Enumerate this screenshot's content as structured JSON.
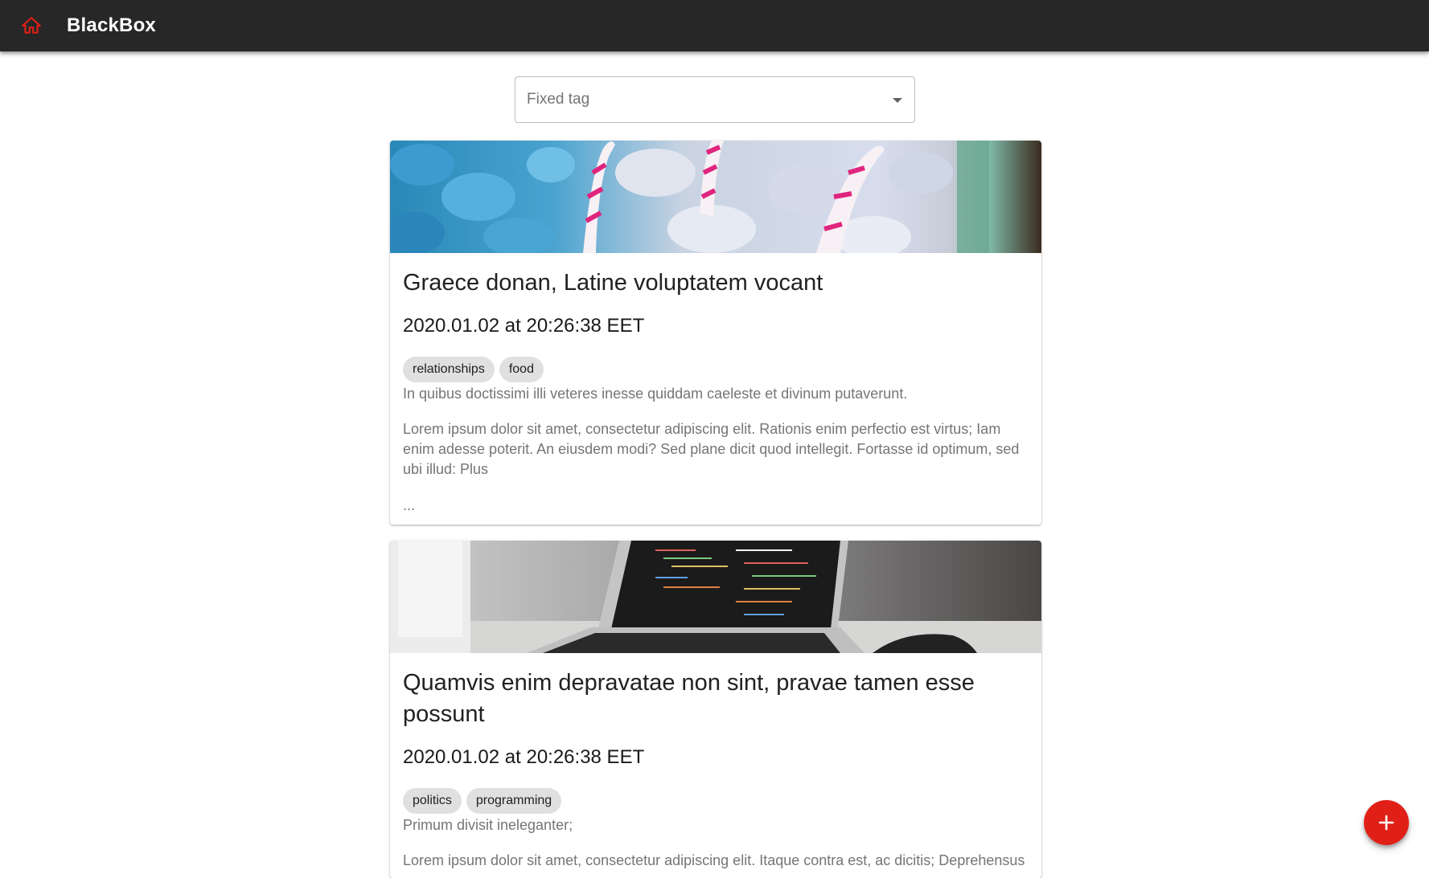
{
  "appbar": {
    "title": "BlackBox",
    "home_icon": "home-icon",
    "accent_color": "#e02017",
    "background": "#272727"
  },
  "filter": {
    "label": "Fixed tag",
    "icon": "arrow-drop-down-icon"
  },
  "posts": [
    {
      "title": "Graece donan, Latine voluptatem vocant",
      "date": "2020.01.02 at 20:26:38 EET",
      "tags": [
        "relationships",
        "food"
      ],
      "subtitle": "In quibus doctissimi illi veteres inesse quiddam caeleste et divinum putaverunt.",
      "excerpt": "Lorem ipsum dolor sit amet, consectetur adipiscing elit. Rationis enim perfectio est virtus; Iam enim adesse poterit. An eiusdem modi? Sed plane dicit quod intellegit. Fortasse id optimum, sed ubi illud: Plus",
      "ellipsis": "...",
      "image": "candy-canes-photo"
    },
    {
      "title": "Quamvis enim depravatae non sint, pravae tamen esse possunt",
      "date": "2020.01.02 at 20:26:38 EET",
      "tags": [
        "politics",
        "programming"
      ],
      "subtitle": "Primum divisit ineleganter;",
      "excerpt": "Lorem ipsum dolor sit amet, consectetur adipiscing elit. Itaque contra est, ac dicitis; Deprehensus",
      "image": "laptop-code-photo"
    }
  ],
  "fab": {
    "icon": "add-icon",
    "color": "#e02017"
  }
}
